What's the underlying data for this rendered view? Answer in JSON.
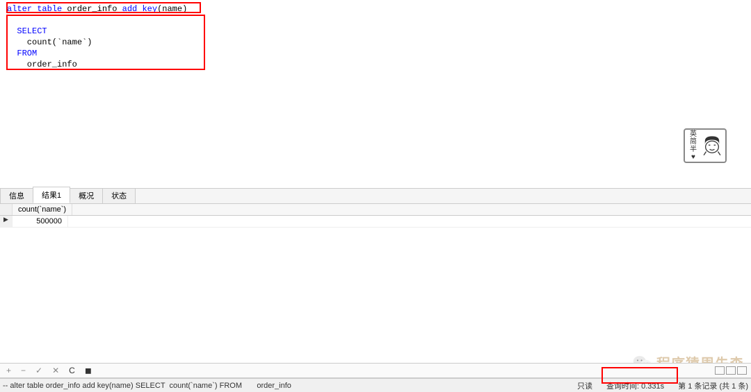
{
  "editor": {
    "line1_alter": "alter",
    "line1_table": "table",
    "line1_tablename": " order_info ",
    "line1_add": "add",
    "line1_key": "key",
    "line1_paren": "(name)",
    "line2_select": "SELECT",
    "line3_count": "    count(`name`)",
    "line4_from": "FROM",
    "line5_table": "    order_info"
  },
  "sticker": {
    "c1": "英",
    "c2": "简",
    "c3": "半",
    "heart": "♥"
  },
  "tabs": {
    "info": "信息",
    "result1": "结果1",
    "profile": "概况",
    "status": "状态"
  },
  "grid": {
    "header_col1": "count(`name`)",
    "row1_col1": "500000",
    "row_pointer": "▶"
  },
  "toolbar": {
    "plus": "+",
    "minus": "−",
    "check": "✓",
    "x": "✕",
    "refresh": "C",
    "stop": "◼"
  },
  "statusbar": {
    "query": "-- alter table order_info add key(name) SELECT  count(`name`) FROM       order_info",
    "readonly": "只读",
    "querytime": "查询时间: 0.331s",
    "records": "第 1 条记录 (共 1 条)"
  },
  "watermark": {
    "text": "程序猿周先森"
  }
}
